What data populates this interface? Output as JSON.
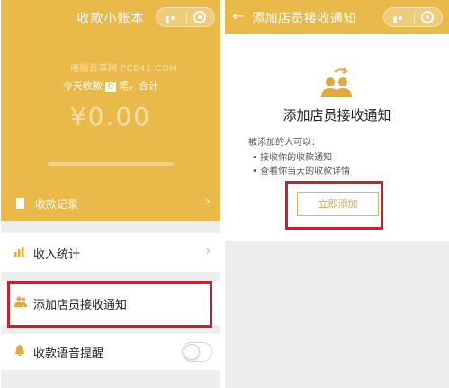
{
  "left": {
    "title": "收款小账本",
    "watermark": "电脑百事网 PC841.COM",
    "count_prefix": "今天收款",
    "count_value": "0",
    "count_suffix": "笔，合计",
    "amount": "¥0.00",
    "records_label": "收款记录",
    "rows": {
      "income": "收入统计",
      "add_staff": "添加店员接收通知",
      "voice": "收款语音提醒"
    },
    "voice_toggle_on": false
  },
  "right": {
    "title": "添加店员接收通知",
    "card_title": "添加店员接收通知",
    "permission_intro": "被添加的人可以：",
    "bullets": [
      "• 接收你的收款通知",
      "• 查看你当天的收款详情"
    ],
    "add_button": "立即添加"
  },
  "colors": {
    "brand_yellow": "#e9b94a",
    "highlight_red": "#c9202c"
  },
  "icons": [
    "back-arrow-icon",
    "more-dots-icon",
    "close-target-icon",
    "receipt-icon",
    "bar-chart-icon",
    "staff-icon",
    "bell-icon",
    "chevron-right-icon",
    "add-staff-icon"
  ]
}
